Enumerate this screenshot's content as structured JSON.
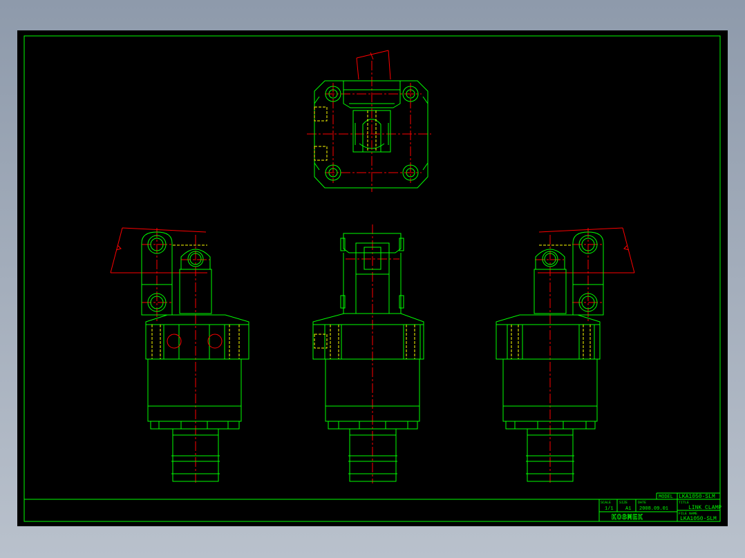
{
  "colors": {
    "background": "#000000",
    "outline": "#00ff00",
    "centerline": "#ff0000",
    "hidden": "#ffff00",
    "surround": "#9aa4b2"
  },
  "drawing": {
    "title_block": {
      "model_label": "MODEL",
      "model_value": "LKA1050-SLM",
      "title_label": "TITLE",
      "title_value": "LINK CLAMP",
      "file_name_label": "FILE NAME",
      "file_name_value": "LKA1050-SLM",
      "scale_label": "SCALE",
      "scale_value": "1/1",
      "size_label": "SIZE",
      "size_value": "A1",
      "date_label": "DATE",
      "date_value": "2008.09.01",
      "logo_text": "KOSMEK"
    },
    "views": [
      "top-view",
      "left-side-view",
      "front-view",
      "right-side-view"
    ]
  }
}
